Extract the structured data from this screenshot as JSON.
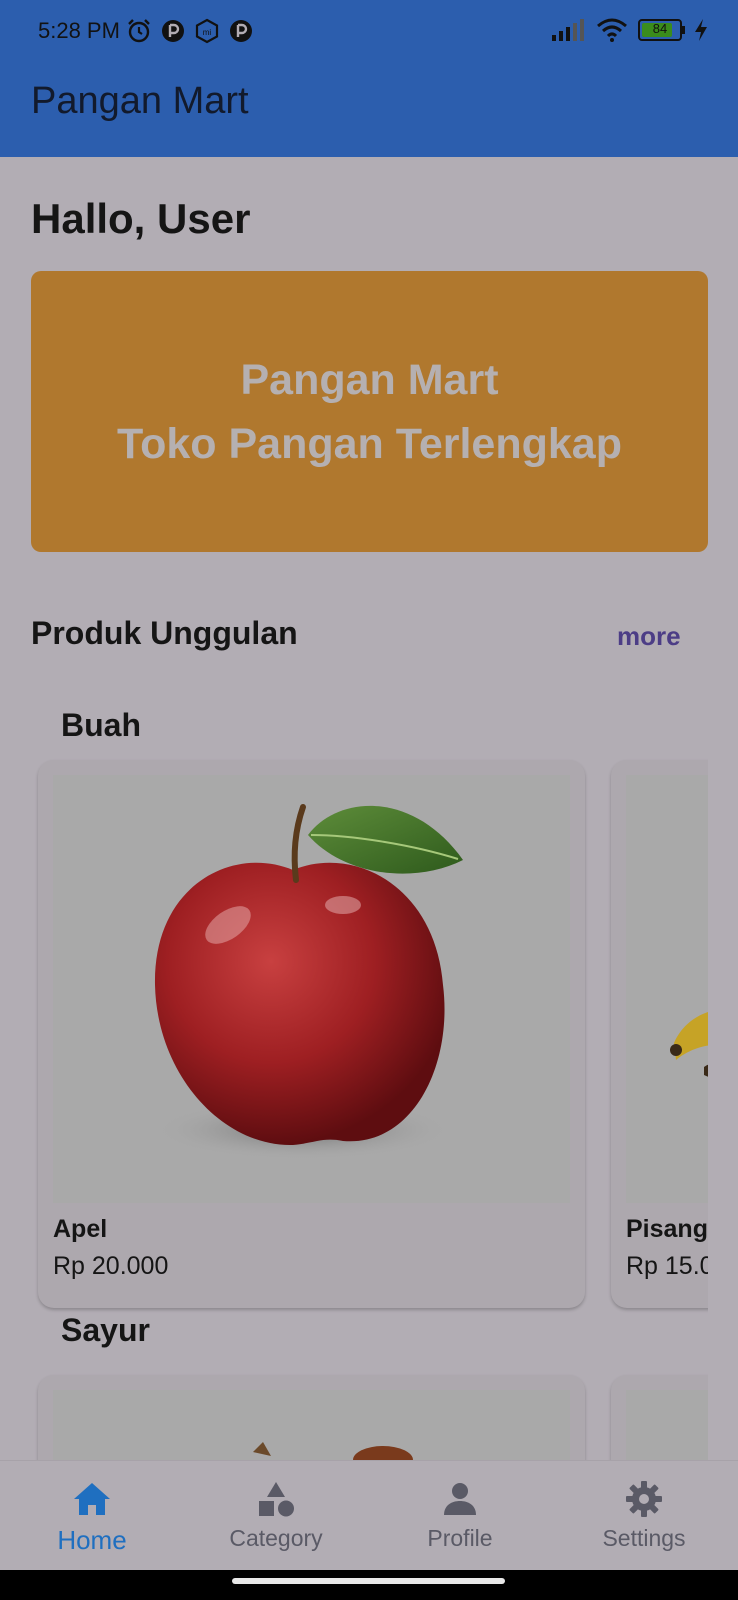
{
  "status_bar": {
    "time": "5:28 PM",
    "battery": "84"
  },
  "app_bar": {
    "title": "Pangan Mart"
  },
  "greeting": "Hallo, User",
  "banner": {
    "line1": "Pangan Mart",
    "line2": "Toko Pangan Terlengkap"
  },
  "featured": {
    "title": "Produk Unggulan",
    "more_label": "more"
  },
  "categories": [
    {
      "name": "Buah",
      "products": [
        {
          "name": "Apel",
          "price": "Rp 20.000"
        },
        {
          "name": "Pisang",
          "price": "Rp 15.0"
        }
      ]
    },
    {
      "name": "Sayur",
      "products": []
    }
  ],
  "bottom_nav": {
    "items": [
      {
        "label": "Home",
        "icon": "home-icon",
        "active": true
      },
      {
        "label": "Category",
        "icon": "category-icon",
        "active": false
      },
      {
        "label": "Profile",
        "icon": "person-icon",
        "active": false
      },
      {
        "label": "Settings",
        "icon": "gear-icon",
        "active": false
      }
    ]
  },
  "colors": {
    "app_bar": "#2c5eae",
    "banner": "#b0782e",
    "active_nav": "#1f6fc0",
    "more_link": "#4c3d86"
  }
}
